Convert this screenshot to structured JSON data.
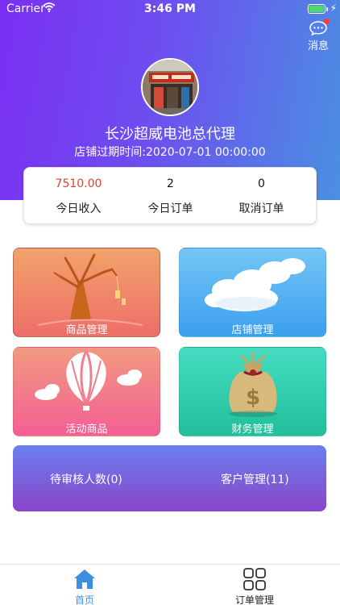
{
  "status_bar": {
    "carrier": "Carrier",
    "time": "3:46 PM"
  },
  "header": {
    "message_label": "消息",
    "store_name": "长沙超威电池总代理",
    "expire_text": "店铺过期时间:2020-07-01 00:00:00"
  },
  "stats": {
    "income": {
      "value": "7510.00",
      "label": "今日收入"
    },
    "orders": {
      "value": "2",
      "label": "今日订单"
    },
    "cancelled": {
      "value": "0",
      "label": "取消订单"
    }
  },
  "tiles": {
    "goods": "商品管理",
    "shop": "店铺管理",
    "activity": "活动商品",
    "finance": "财务管理"
  },
  "bottom_panel": {
    "pending": "待审核人数(0)",
    "customers": "客户管理(11)"
  },
  "tabbar": {
    "home": "首页",
    "orders": "订单管理"
  },
  "colors": {
    "header_gradient_start": "#7b2ff2",
    "header_gradient_end": "#4a90e2",
    "income_red": "#e33d2f",
    "tab_active": "#3d8fe0"
  },
  "icons": [
    "wifi-icon",
    "battery-icon",
    "message-icon",
    "home-icon",
    "grid-icon",
    "tree-icon",
    "cloud-icon",
    "balloon-icon",
    "money-bag-icon"
  ]
}
